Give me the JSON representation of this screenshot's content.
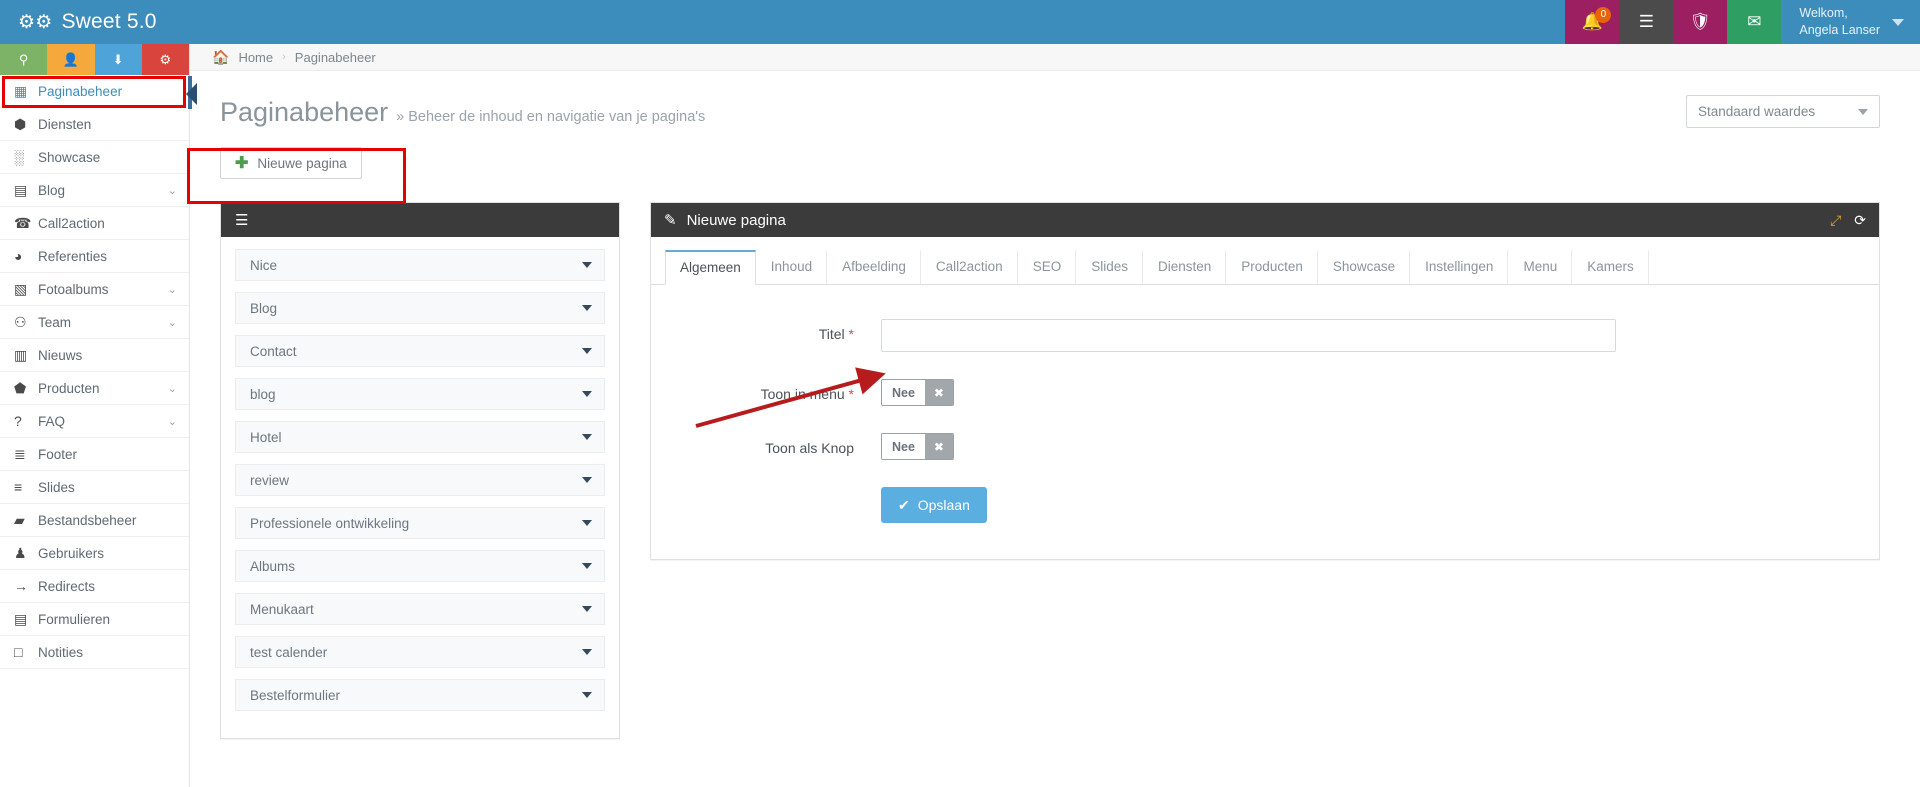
{
  "topbar": {
    "brand": "Sweet 5.0",
    "brand_icon": "gears-icon",
    "icons": [
      {
        "name": "bell-icon",
        "glyph": "❖",
        "badge": "0"
      },
      {
        "name": "list-icon",
        "glyph": "☰",
        "badge": ""
      },
      {
        "name": "shield-icon",
        "glyph": "⬟",
        "badge": ""
      },
      {
        "name": "envelope-icon",
        "glyph": "✉",
        "badge": ""
      }
    ],
    "user": {
      "greeting": "Welkom,",
      "name": "Angela Lanser"
    }
  },
  "quick_actions": [
    {
      "name": "map-marker-icon",
      "glyph": "⌂",
      "color": "#7cb366"
    },
    {
      "name": "user-icon",
      "glyph": "♟",
      "color": "#f5a83c"
    },
    {
      "name": "download-icon",
      "glyph": "⬇",
      "color": "#4ea3d8"
    },
    {
      "name": "gears-icon",
      "glyph": "⚙",
      "color": "#d9453c"
    }
  ],
  "sidebar": {
    "items": [
      {
        "label": "Paginabeheer",
        "icon": "table-icon",
        "glyph": "▦",
        "chevron": false,
        "active": true
      },
      {
        "label": "Diensten",
        "icon": "cubes-icon",
        "glyph": "⬢",
        "chevron": false,
        "active": false
      },
      {
        "label": "Showcase",
        "icon": "grid-icon",
        "glyph": "░",
        "chevron": false,
        "active": false
      },
      {
        "label": "Blog",
        "icon": "document-icon",
        "glyph": "▤",
        "chevron": true,
        "active": false
      },
      {
        "label": "Call2action",
        "icon": "phone-icon",
        "glyph": "☎",
        "chevron": false,
        "active": false
      },
      {
        "label": "Referenties",
        "icon": "comments-icon",
        "glyph": "◕",
        "chevron": false,
        "active": false
      },
      {
        "label": "Fotoalbums",
        "icon": "book-icon",
        "glyph": "▧",
        "chevron": true,
        "active": false
      },
      {
        "label": "Team",
        "icon": "users-icon",
        "glyph": "⚇",
        "chevron": true,
        "active": false
      },
      {
        "label": "Nieuws",
        "icon": "newspaper-icon",
        "glyph": "▥",
        "chevron": false,
        "active": false
      },
      {
        "label": "Producten",
        "icon": "tags-icon",
        "glyph": "⬟",
        "chevron": true,
        "active": false
      },
      {
        "label": "FAQ",
        "icon": "question-icon",
        "glyph": "?",
        "chevron": true,
        "active": false
      },
      {
        "label": "Footer",
        "icon": "list-alt-icon",
        "glyph": "≣",
        "chevron": false,
        "active": false
      },
      {
        "label": "Slides",
        "icon": "sliders-icon",
        "glyph": "≡",
        "chevron": false,
        "active": false
      },
      {
        "label": "Bestandsbeheer",
        "icon": "folder-icon",
        "glyph": "▰",
        "chevron": false,
        "active": false
      },
      {
        "label": "Gebruikers",
        "icon": "user-icon",
        "glyph": "♟",
        "chevron": false,
        "active": false
      },
      {
        "label": "Redirects",
        "icon": "arrow-circle-icon",
        "glyph": "→",
        "chevron": false,
        "active": false
      },
      {
        "label": "Formulieren",
        "icon": "form-icon",
        "glyph": "▤",
        "chevron": false,
        "active": false
      },
      {
        "label": "Notities",
        "icon": "note-icon",
        "glyph": "□",
        "chevron": false,
        "active": false
      }
    ]
  },
  "breadcrumb": {
    "home_icon": "home-icon",
    "home": "Home",
    "separator": "›",
    "current": "Paginabeheer"
  },
  "page": {
    "title": "Paginabeheer",
    "subtitle": "» Beheer de inhoud en navigatie van je pagina's",
    "preset_select": "Standaard waardes",
    "new_page_button": "Nieuwe pagina",
    "new_page_plus": "＋"
  },
  "pagelist": {
    "menu_icon": "hamburger-icon",
    "menu_glyph": "☰",
    "items": [
      {
        "label": "Nice",
        "color": "#c2cf6c"
      },
      {
        "label": "Blog",
        "color": "#c2cf6c"
      },
      {
        "label": "Contact",
        "color": "#c2cf6c"
      },
      {
        "label": "blog",
        "color": "#b0505a"
      },
      {
        "label": "Hotel",
        "color": "#b0505a"
      },
      {
        "label": "review",
        "color": "#b0505a"
      },
      {
        "label": "Professionele ontwikkeling",
        "color": "#b0505a"
      },
      {
        "label": "Albums",
        "color": "#b0505a"
      },
      {
        "label": "Menukaart",
        "color": "#b0505a"
      },
      {
        "label": "test calender",
        "color": "#b0505a"
      },
      {
        "label": "Bestelformulier",
        "color": "#b0505a"
      }
    ]
  },
  "form_panel": {
    "title": "Nieuwe pagina",
    "title_icon": "edit-icon",
    "title_glyph": "✎",
    "expand_icon": "expand-icon",
    "expand_glyph": "⤢",
    "refresh_icon": "refresh-icon",
    "refresh_glyph": "⟳",
    "tabs": [
      {
        "label": "Algemeen",
        "active": true
      },
      {
        "label": "Inhoud",
        "active": false
      },
      {
        "label": "Afbeelding",
        "active": false
      },
      {
        "label": "Call2action",
        "active": false
      },
      {
        "label": "SEO",
        "active": false
      },
      {
        "label": "Slides",
        "active": false
      },
      {
        "label": "Diensten",
        "active": false
      },
      {
        "label": "Producten",
        "active": false
      },
      {
        "label": "Showcase",
        "active": false
      },
      {
        "label": "Instellingen",
        "active": false
      },
      {
        "label": "Menu",
        "active": false
      },
      {
        "label": "Kamers",
        "active": false
      }
    ],
    "fields": {
      "titel_label": "Titel",
      "titel_value": "",
      "titel_placeholder": "",
      "toon_in_menu_label": "Toon in menu",
      "toon_in_menu_value": "Nee",
      "toon_als_knop_label": "Toon als Knop",
      "toon_als_knop_value": "Nee",
      "required_mark": "*",
      "toggle_clear_glyph": "✖"
    },
    "save_button": "Opslaan",
    "save_check": "✔"
  },
  "colors": {
    "brand_blue": "#3c8dbc",
    "accent_red": "#e60000",
    "save_blue": "#5bafe0",
    "panel_dark": "#3b3b3b"
  }
}
